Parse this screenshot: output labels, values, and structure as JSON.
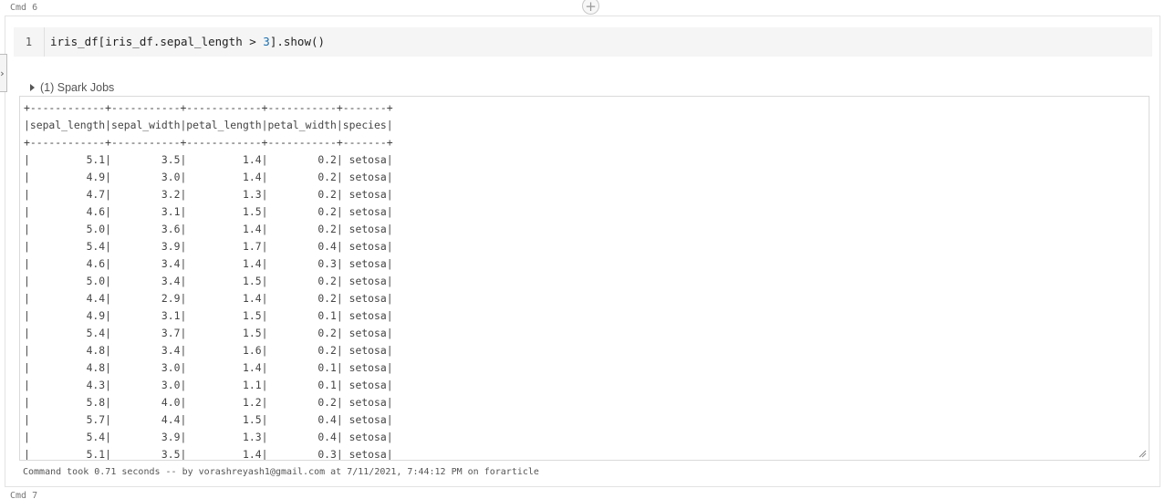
{
  "cells": {
    "current_label": "Cmd 6",
    "next_label": "Cmd 7",
    "add_cell_icon": "+"
  },
  "sidebar": {
    "toggle_icon": "chevron-right",
    "toggle_glyph": "›"
  },
  "editor": {
    "line_number": "1",
    "code_before_number": "iris_df[iris_df.sepal_length > ",
    "code_number": "3",
    "code_after_number": "].show()"
  },
  "spark_jobs": {
    "label": "(1) Spark Jobs"
  },
  "output": {
    "columns": [
      "sepal_length",
      "sepal_width",
      "petal_length",
      "petal_width",
      "species"
    ],
    "rows": [
      [
        "5.1",
        "3.5",
        "1.4",
        "0.2",
        "setosa"
      ],
      [
        "4.9",
        "3.0",
        "1.4",
        "0.2",
        "setosa"
      ],
      [
        "4.7",
        "3.2",
        "1.3",
        "0.2",
        "setosa"
      ],
      [
        "4.6",
        "3.1",
        "1.5",
        "0.2",
        "setosa"
      ],
      [
        "5.0",
        "3.6",
        "1.4",
        "0.2",
        "setosa"
      ],
      [
        "5.4",
        "3.9",
        "1.7",
        "0.4",
        "setosa"
      ],
      [
        "4.6",
        "3.4",
        "1.4",
        "0.3",
        "setosa"
      ],
      [
        "5.0",
        "3.4",
        "1.5",
        "0.2",
        "setosa"
      ],
      [
        "4.4",
        "2.9",
        "1.4",
        "0.2",
        "setosa"
      ],
      [
        "4.9",
        "3.1",
        "1.5",
        "0.1",
        "setosa"
      ],
      [
        "5.4",
        "3.7",
        "1.5",
        "0.2",
        "setosa"
      ],
      [
        "4.8",
        "3.4",
        "1.6",
        "0.2",
        "setosa"
      ],
      [
        "4.8",
        "3.0",
        "1.4",
        "0.1",
        "setosa"
      ],
      [
        "4.3",
        "3.0",
        "1.1",
        "0.1",
        "setosa"
      ],
      [
        "5.8",
        "4.0",
        "1.2",
        "0.2",
        "setosa"
      ],
      [
        "5.7",
        "4.4",
        "1.5",
        "0.4",
        "setosa"
      ],
      [
        "5.4",
        "3.9",
        "1.3",
        "0.4",
        "setosa"
      ],
      [
        "5.1",
        "3.5",
        "1.4",
        "0.3",
        "setosa"
      ]
    ]
  },
  "footer": {
    "status": "Command took 0.71 seconds -- by vorashreyash1@gmail.com at 7/11/2021, 7:44:12 PM on forarticle"
  }
}
